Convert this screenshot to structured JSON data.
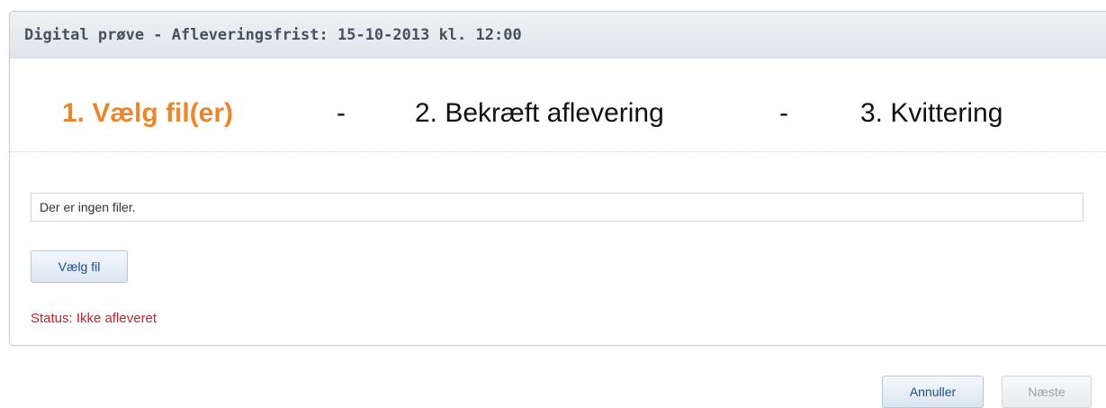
{
  "panel": {
    "title": "Digital prøve - Afleveringsfrist: 15-10-2013 kl. 12:00"
  },
  "steps": {
    "step1": "1. Vælg fil(er)",
    "separator": "-",
    "step2": "2. Bekræft aflevering",
    "step3": "3. Kvittering",
    "active_color": "#e8872d"
  },
  "files": {
    "empty_text": "Der er ingen filer."
  },
  "actions": {
    "choose_file": "Vælg fil",
    "cancel": "Annuller",
    "next": "Næste"
  },
  "status": {
    "text": "Status: Ikke afleveret",
    "color": "#b5282e"
  }
}
